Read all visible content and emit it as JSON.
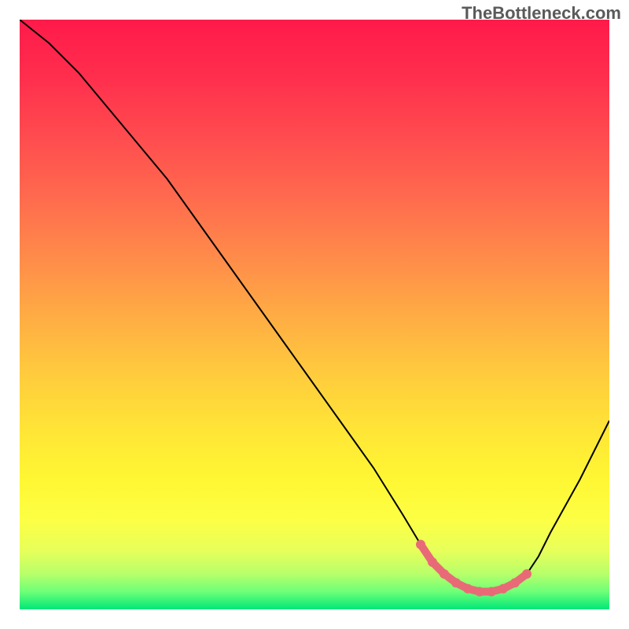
{
  "watermark": "TheBottleneck.com",
  "chart_data": {
    "type": "line",
    "title": "",
    "xlabel": "",
    "ylabel": "",
    "xlim": [
      0,
      100
    ],
    "ylim": [
      0,
      100
    ],
    "series": [
      {
        "name": "bottleneck-curve",
        "x": [
          0,
          5,
          10,
          15,
          20,
          25,
          30,
          35,
          40,
          45,
          50,
          55,
          60,
          65,
          68,
          70,
          72,
          74,
          76,
          78,
          80,
          82,
          84,
          86,
          88,
          90,
          95,
          100
        ],
        "y": [
          100,
          96,
          91,
          85,
          79,
          73,
          66,
          59,
          52,
          45,
          38,
          31,
          24,
          16,
          11,
          8,
          6,
          4,
          3,
          2.5,
          2.5,
          3,
          4,
          6,
          9,
          13,
          22,
          32
        ],
        "color": "#000000"
      },
      {
        "name": "highlight-dots",
        "x": [
          68,
          70,
          72,
          74,
          76,
          78,
          80,
          82,
          84,
          86
        ],
        "y": [
          11,
          8,
          6,
          4.5,
          3.5,
          3,
          3,
          3.5,
          4.5,
          6
        ],
        "color": "#e96a77"
      }
    ],
    "gradient_stops": [
      {
        "offset": 0.0,
        "color": "#ff1a4a"
      },
      {
        "offset": 0.1,
        "color": "#ff2f4d"
      },
      {
        "offset": 0.2,
        "color": "#ff4c4f"
      },
      {
        "offset": 0.3,
        "color": "#ff6a4e"
      },
      {
        "offset": 0.4,
        "color": "#ff8a4a"
      },
      {
        "offset": 0.5,
        "color": "#ffab44"
      },
      {
        "offset": 0.6,
        "color": "#ffcb3d"
      },
      {
        "offset": 0.7,
        "color": "#ffe636"
      },
      {
        "offset": 0.78,
        "color": "#fff733"
      },
      {
        "offset": 0.85,
        "color": "#fcff45"
      },
      {
        "offset": 0.9,
        "color": "#e8ff5a"
      },
      {
        "offset": 0.94,
        "color": "#b7ff6a"
      },
      {
        "offset": 0.97,
        "color": "#6eff78"
      },
      {
        "offset": 1.0,
        "color": "#00e878"
      }
    ]
  }
}
